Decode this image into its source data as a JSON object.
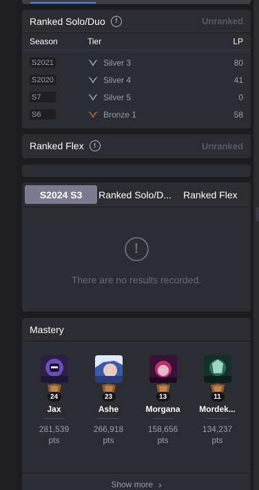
{
  "ranked_solo": {
    "title": "Ranked Solo/Duo",
    "status": "Unranked",
    "col_season": "Season",
    "col_tier": "Tier",
    "col_lp": "LP",
    "rows": [
      {
        "season": "S2021",
        "tier": "Silver 3",
        "lp": "80",
        "emblem": "silver"
      },
      {
        "season": "S2020",
        "tier": "Silver 4",
        "lp": "41",
        "emblem": "silver"
      },
      {
        "season": "S7",
        "tier": "Silver 5",
        "lp": "0",
        "emblem": "silver"
      },
      {
        "season": "S6",
        "tier": "Bronze 1",
        "lp": "58",
        "emblem": "bronze"
      }
    ]
  },
  "ranked_flex": {
    "title": "Ranked Flex",
    "status": "Unranked"
  },
  "season_tabs": {
    "tabs": [
      "S2024 S3",
      "Ranked Solo/D...",
      "Ranked Flex"
    ],
    "empty_text": "There are no results recorded."
  },
  "mastery": {
    "title": "Mastery",
    "show_more": "Show more",
    "champions": [
      {
        "name": "Jax",
        "level": "24",
        "points": "281,539",
        "unit": "pts"
      },
      {
        "name": "Ashe",
        "level": "23",
        "points": "266,918",
        "unit": "pts"
      },
      {
        "name": "Morgana",
        "level": "13",
        "points": "158,656",
        "unit": "pts"
      },
      {
        "name": "Mordek...",
        "level": "11",
        "points": "134,237",
        "unit": "pts"
      }
    ]
  },
  "colors": {
    "background": "#1c1c1f",
    "card": "#2c2c33",
    "muted_text": "#9e9eb1",
    "active_tab": "#7b7a8e",
    "silver": "#8fa6a8",
    "bronze": "#b0643a"
  }
}
